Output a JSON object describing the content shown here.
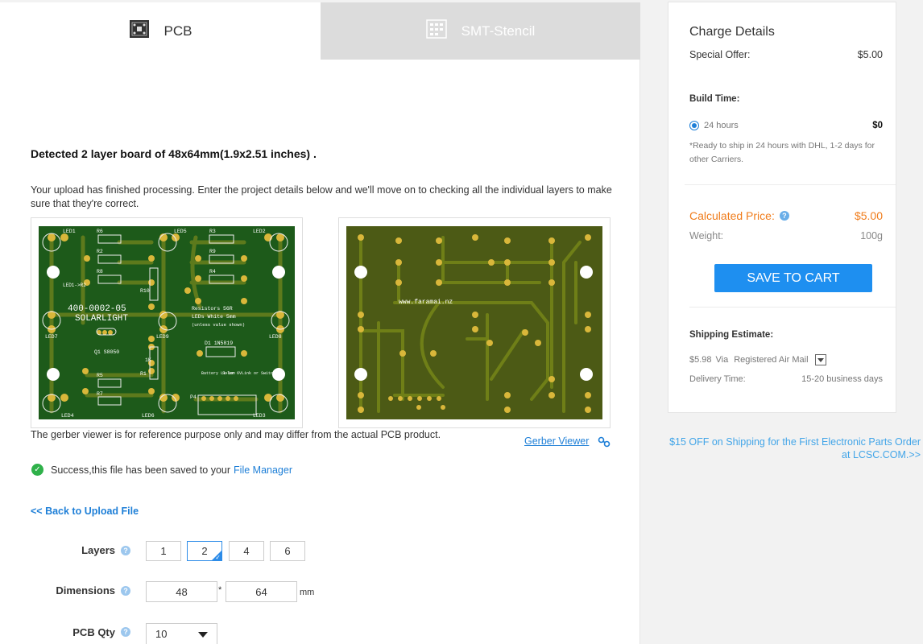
{
  "tabs": [
    {
      "label": "PCB",
      "icon": "pcb-icon",
      "active": true
    },
    {
      "label": "SMT-Stencil",
      "icon": "stencil-icon",
      "active": false
    }
  ],
  "upload": {
    "detected": "Detected 2 layer board of 48x64mm(1.9x2.51 inches) .",
    "description": "Your upload has finished processing. Enter the project details below and we'll move on to checking all the individual layers to make sure that they're correct.",
    "viewer_note": "The gerber viewer is for reference purpose only and may differ from the actual PCB product.",
    "gerber_viewer_label": "Gerber Viewer",
    "success_text": "Success,this file has been saved to your",
    "file_manager_link": "File Manager",
    "back_link": "<< Back to Upload File"
  },
  "pcb_top_text": {
    "part_number": "400-0002-05",
    "name": "SOLARLIGHT",
    "resistors": "Resistors 56R",
    "leds": "LEDs White 5mm",
    "otherwise": "(unless value shown)",
    "diode": "D1 1N5819",
    "transistor": "Q1 S8050",
    "labels": [
      "LED1",
      "LED2",
      "LED3",
      "LED4",
      "LED5",
      "LED6",
      "LED7",
      "LED8",
      "LED9",
      "R1",
      "R2",
      "R3",
      "R4",
      "R5",
      "R6",
      "R7",
      "R8",
      "R9",
      "R10",
      "P4"
    ],
    "r1_value": "1K",
    "r10_value": "R10",
    "led1_r2": "LED1->R2",
    "connector_labels": [
      "Battery Li-ion",
      "Solar 6V",
      "Link or Switch"
    ]
  },
  "pcb_bottom_text": {
    "url": "www.faramai.nz"
  },
  "form": {
    "layers_label": "Layers",
    "layers": [
      "1",
      "2",
      "4",
      "6"
    ],
    "selected_layer": "2",
    "dimensions_label": "Dimensions",
    "width": "48",
    "height": "64",
    "separator": "*",
    "unit": "mm",
    "qty_label": "PCB Qty",
    "qty_value": "10"
  },
  "charge": {
    "title": "Charge Details",
    "special_offer_label": "Special Offer:",
    "special_offer_value": "$5.00",
    "build_time_label": "Build Time:",
    "build_option": "24 hours",
    "build_price": "$0",
    "build_note": "*Ready to ship in 24 hours with DHL, 1-2 days for other Carriers.",
    "calc_label": "Calculated Price:",
    "calc_value": "$5.00",
    "weight_label": "Weight:",
    "weight_value": "100g",
    "save_button": "SAVE TO CART",
    "shipping_label": "Shipping Estimate:",
    "shipping_price": "$5.98",
    "shipping_via": "Via",
    "shipping_method": "Registered Air Mail",
    "delivery_label": "Delivery Time:",
    "delivery_value": "15-20 business days"
  },
  "promo": "$15 OFF on Shipping for the First Electronic Parts Order at LCSC.COM.>>",
  "colors": {
    "accent": "#1e8ff0",
    "link": "#1e7fd7",
    "price": "#f07c1b",
    "pcb_top": "#1d5a1a",
    "pcb_bottom": "#4c5a15",
    "pad": "#d9b73a"
  }
}
